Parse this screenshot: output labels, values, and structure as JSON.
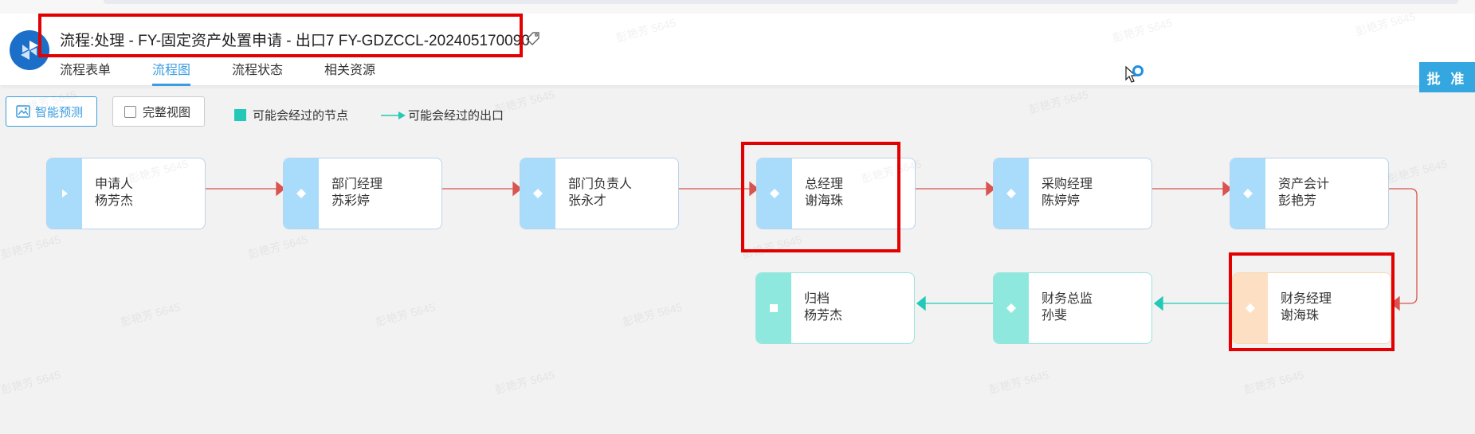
{
  "header": {
    "title": "流程:处理 - FY-固定资产处置申请 - 出口7 FY-GDZCCL-202405170090",
    "approve_label": "批 准"
  },
  "tabs": [
    {
      "label": "流程表单"
    },
    {
      "label": "流程图"
    },
    {
      "label": "流程状态"
    },
    {
      "label": "相关资源"
    }
  ],
  "toolbar": {
    "predict_label": "智能预测",
    "full_view_label": "完整视图",
    "legend_node_label": "可能会经过的节点",
    "legend_exit_label": "可能会经过的出口"
  },
  "nodes": [
    {
      "role": "申请人",
      "person": "杨芳杰",
      "icon": "play-icon"
    },
    {
      "role": "部门经理",
      "person": "苏彩婷",
      "icon": "diamond-icon"
    },
    {
      "role": "部门负责人",
      "person": "张永才",
      "icon": "diamond-icon"
    },
    {
      "role": "总经理",
      "person": "谢海珠",
      "icon": "diamond-icon"
    },
    {
      "role": "采购经理",
      "person": "陈婷婷",
      "icon": "diamond-icon"
    },
    {
      "role": "资产会计",
      "person": "彭艳芳",
      "icon": "diamond-icon"
    },
    {
      "role": "财务经理",
      "person": "谢海珠",
      "icon": "diamond-icon"
    },
    {
      "role": "财务总监",
      "person": "孙斐",
      "icon": "diamond-icon"
    },
    {
      "role": "归档",
      "person": "杨芳杰",
      "icon": "square-icon"
    }
  ],
  "watermark": "彭艳芳 5645",
  "colors": {
    "accent": "#3a9de0",
    "past_edge": "#d9534f",
    "possible_edge": "#21c9b6",
    "highlight": "#e30000"
  }
}
